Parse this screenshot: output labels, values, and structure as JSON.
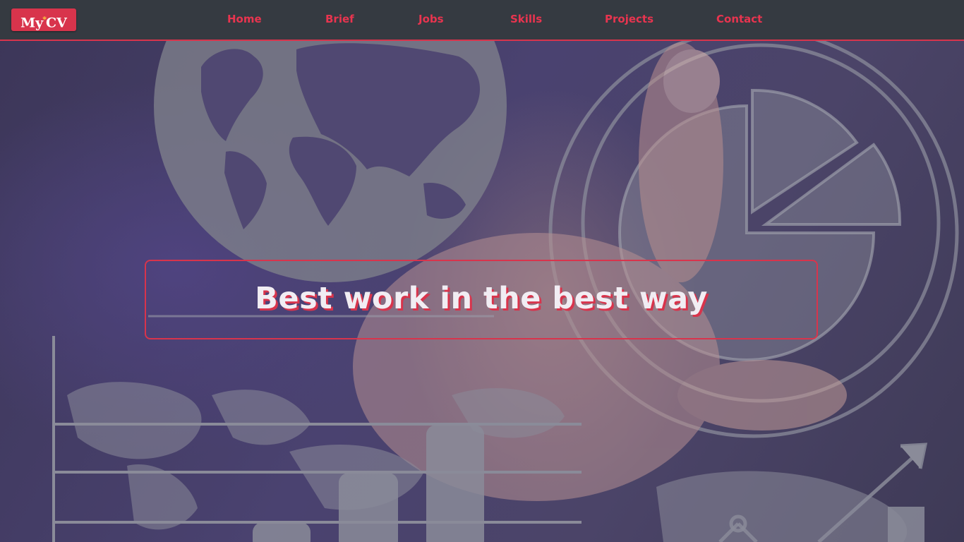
{
  "header": {
    "logo": {
      "left": "My",
      "star": "*",
      "right": "CV"
    },
    "nav": [
      {
        "label": "Home"
      },
      {
        "label": "Brief"
      },
      {
        "label": "Jobs"
      },
      {
        "label": "Skills"
      },
      {
        "label": "Projects"
      },
      {
        "label": "Contact"
      }
    ]
  },
  "hero": {
    "headline": "Best work in the best way"
  },
  "colors": {
    "accent": "#d8344c",
    "header_bg": "#353a41",
    "logo_star": "#ffd23a",
    "headline_text": "#f1edf3"
  }
}
